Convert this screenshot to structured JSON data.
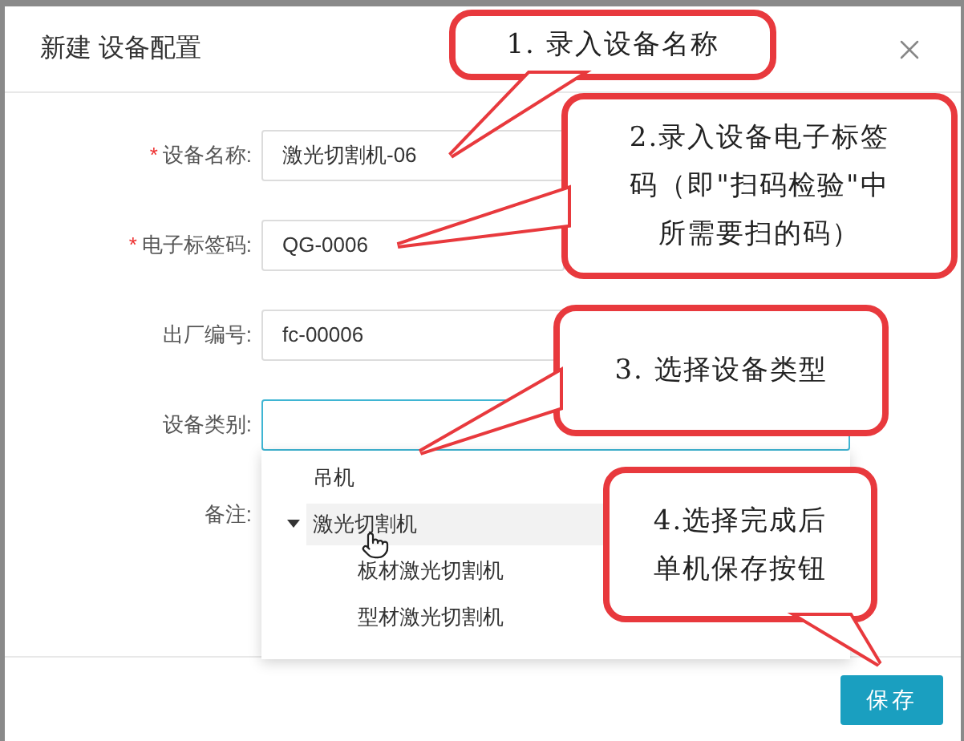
{
  "dialog": {
    "title": "新建 设备配置",
    "fields": [
      {
        "label": "设备名称:",
        "marker": "*",
        "value": "激光切割机-06",
        "focused": false
      },
      {
        "label": "电子标签码:",
        "marker": "*",
        "value": "QG-0006",
        "focused": false
      },
      {
        "label": "出厂编号:",
        "value": "fc-00006",
        "focused": false
      },
      {
        "label": "设备类别:",
        "focused": true
      }
    ],
    "note": {
      "label": "备注:"
    },
    "dropdown": [
      {
        "label": "吊机",
        "selected": false
      },
      {
        "label": "激光切割机",
        "selected": true,
        "expanded": true,
        "children": [
          {
            "label": "板材激光切割机",
            "selected": false
          },
          {
            "label": "型材激光切割机",
            "selected": false
          }
        ]
      }
    ],
    "buttons": [
      {
        "label": "保存",
        "kind": "primary"
      }
    ]
  },
  "callouts": [
    {
      "lines": [
        "1. 录入设备名称"
      ]
    },
    {
      "lines": [
        "2.录入设备电子标签",
        "码（即\"扫码检验\"中",
        "所需要扫的码）"
      ]
    },
    {
      "lines": [
        "3. 选择设备类型"
      ]
    },
    {
      "lines": [
        "4.选择完成后",
        "单机保存按钮"
      ]
    }
  ]
}
